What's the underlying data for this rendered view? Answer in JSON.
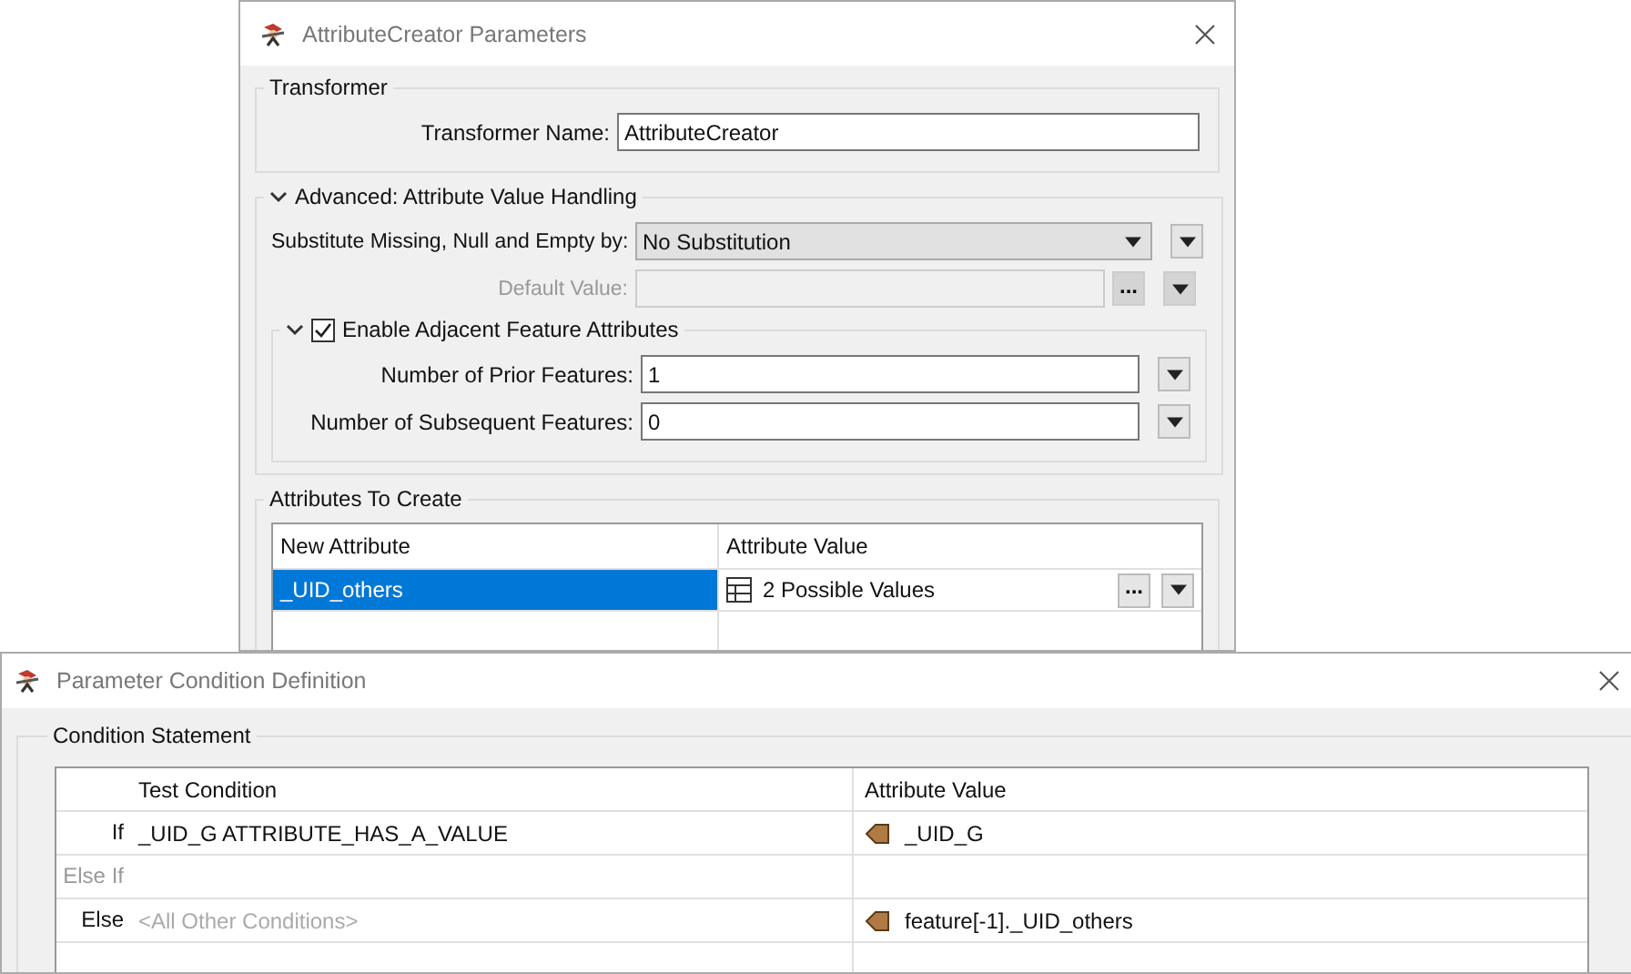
{
  "main_dialog": {
    "title": "AttributeCreator Parameters",
    "transformer_group": {
      "title": "Transformer",
      "name_label": "Transformer Name:",
      "name_value": "AttributeCreator"
    },
    "advanced_group": {
      "title": "Advanced: Attribute Value Handling",
      "expanded": true,
      "substitute_label": "Substitute Missing, Null and Empty by:",
      "substitute_value": "No Substitution",
      "default_label": "Default Value:",
      "default_disabled": true,
      "browse_button": "...",
      "adjacent_group": {
        "title": "Enable Adjacent Feature Attributes",
        "expanded": true,
        "checked": true,
        "fields": [
          {
            "label": "Number of Prior Features:",
            "value": "1"
          },
          {
            "label": "Number of Subsequent Features:",
            "value": "0"
          }
        ]
      }
    },
    "attributes_group": {
      "title": "Attributes To Create",
      "columns": [
        "New Attribute",
        "Attribute Value"
      ],
      "rows": [
        {
          "name": "_UID_others",
          "value": "2 Possible Values",
          "selected": true,
          "browse_button": "..."
        }
      ]
    }
  },
  "condition_dialog": {
    "title": "Parameter Condition Definition",
    "group_title": "Condition Statement",
    "columns": [
      "Test Condition",
      "Attribute Value"
    ],
    "rows": [
      {
        "keyword": "If",
        "keyword_disabled": false,
        "condition": "_UID_G ATTRIBUTE_HAS_A_VALUE",
        "condition_placeholder": false,
        "value": "_UID_G"
      },
      {
        "keyword": "Else If",
        "keyword_disabled": true
      },
      {
        "keyword": "Else",
        "keyword_disabled": false,
        "condition": "<All Other Conditions>",
        "condition_placeholder": true,
        "value": "feature[-1]._UID_others"
      }
    ]
  }
}
